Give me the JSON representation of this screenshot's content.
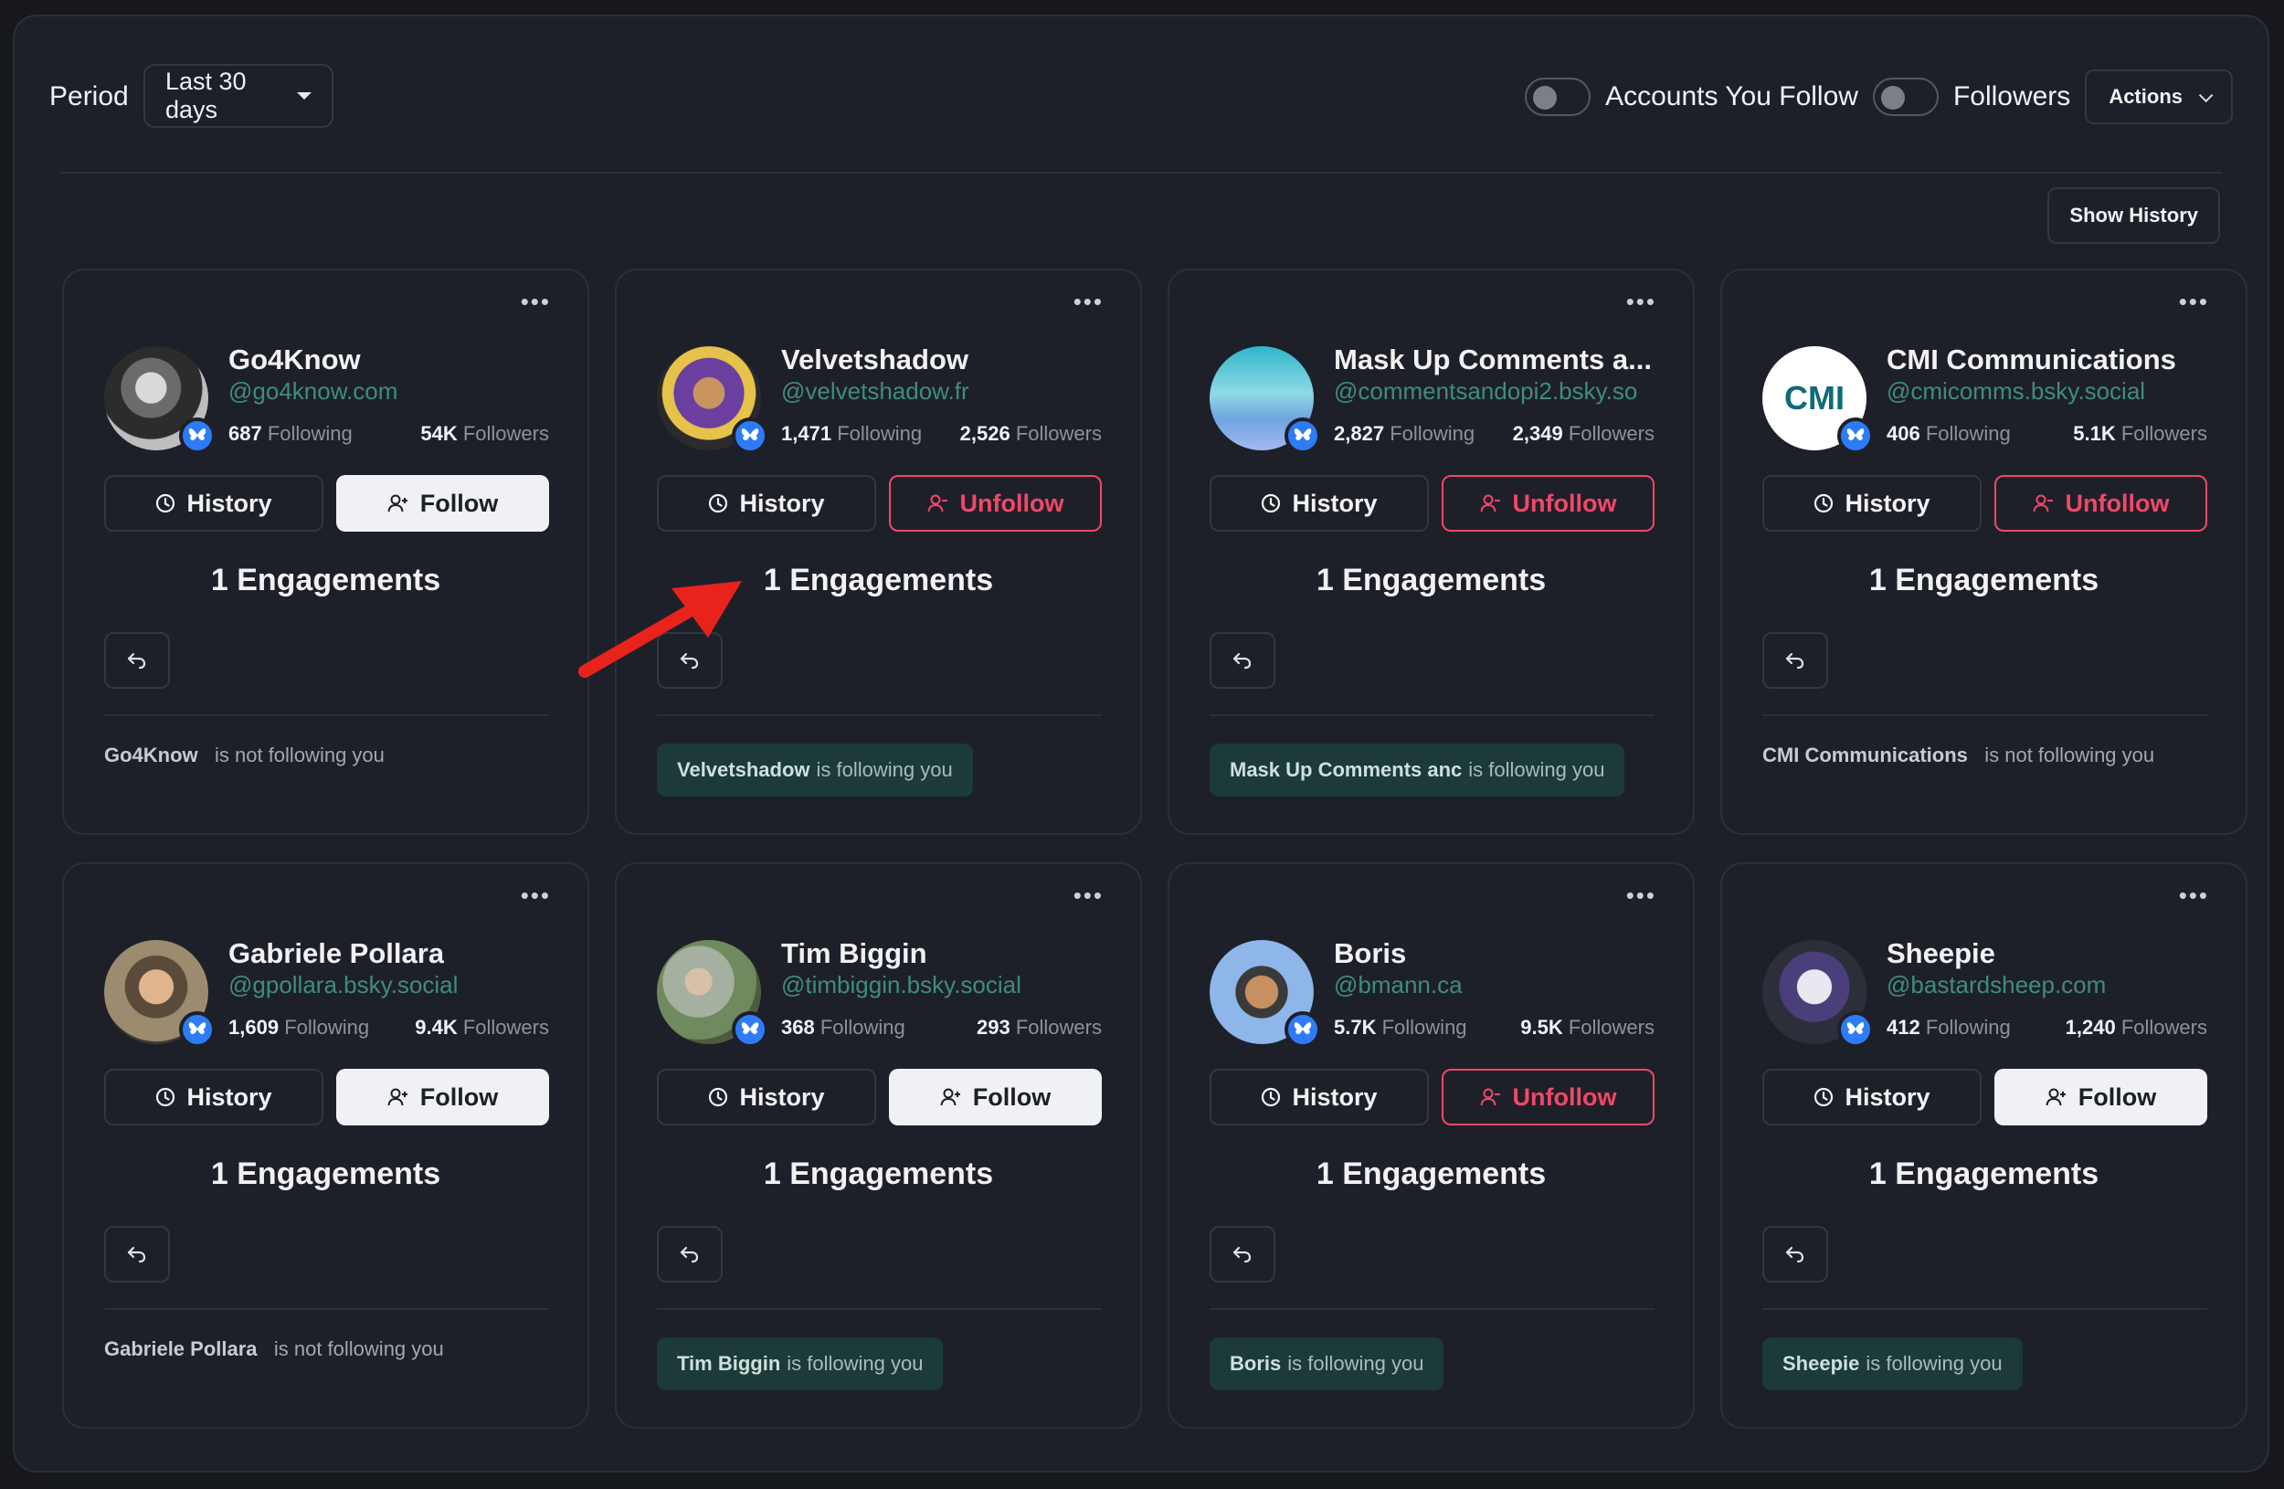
{
  "toolbar": {
    "period_label": "Period",
    "period_value": "Last 30 days",
    "toggle_following_label": "Accounts You Follow",
    "toggle_followers_label": "Followers",
    "actions_label": "Actions",
    "show_history_label": "Show History"
  },
  "colors": {
    "follow_button_bg": "#f0f1f4",
    "unfollow_accent": "#f04868",
    "handle_green": "#3f8d7a",
    "follows_you_pill_bg": "#1b3a39",
    "badge_blue": "#2d7bf7"
  },
  "cards": [
    {
      "name": "Go4Know",
      "handle": "@go4know.com",
      "following": "687",
      "following_label": "Following",
      "followers": "54K",
      "followers_label": "Followers",
      "history_label": "History",
      "action_label": "Follow",
      "engagements": "1 Engagements",
      "status_name": "Go4Know",
      "status_text": "is not following you"
    },
    {
      "name": "Velvetshadow",
      "handle": "@velvetshadow.fr",
      "following": "1,471",
      "following_label": "Following",
      "followers": "2,526",
      "followers_label": "Followers",
      "history_label": "History",
      "action_label": "Unfollow",
      "engagements": "1 Engagements",
      "status_name": "Velvetshadow",
      "status_text": "is following you"
    },
    {
      "name": "Mask Up Comments a...",
      "handle": "@commentsandopi2.bsky.so",
      "following": "2,827",
      "following_label": "Following",
      "followers": "2,349",
      "followers_label": "Followers",
      "history_label": "History",
      "action_label": "Unfollow",
      "engagements": "1 Engagements",
      "status_name": "Mask Up Comments anc",
      "status_text": "is following you"
    },
    {
      "name": "CMI Communications",
      "handle": "@cmicomms.bsky.social",
      "following": "406",
      "following_label": "Following",
      "followers": "5.1K",
      "followers_label": "Followers",
      "history_label": "History",
      "action_label": "Unfollow",
      "engagements": "1 Engagements",
      "status_name": "CMI Communications",
      "status_text": "is not following you",
      "avatar_text": "CMI"
    },
    {
      "name": "Gabriele Pollara",
      "handle": "@gpollara.bsky.social",
      "following": "1,609",
      "following_label": "Following",
      "followers": "9.4K",
      "followers_label": "Followers",
      "history_label": "History",
      "action_label": "Follow",
      "engagements": "1 Engagements",
      "status_name": "Gabriele Pollara",
      "status_text": "is not following you"
    },
    {
      "name": "Tim Biggin",
      "handle": "@timbiggin.bsky.social",
      "following": "368",
      "following_label": "Following",
      "followers": "293",
      "followers_label": "Followers",
      "history_label": "History",
      "action_label": "Follow",
      "engagements": "1 Engagements",
      "status_name": "Tim Biggin",
      "status_text": "is following you"
    },
    {
      "name": "Boris",
      "handle": "@bmann.ca",
      "following": "5.7K",
      "following_label": "Following",
      "followers": "9.5K",
      "followers_label": "Followers",
      "history_label": "History",
      "action_label": "Unfollow",
      "engagements": "1 Engagements",
      "status_name": "Boris",
      "status_text": "is following you"
    },
    {
      "name": "Sheepie",
      "handle": "@bastardsheep.com",
      "following": "412",
      "following_label": "Following",
      "followers": "1,240",
      "followers_label": "Followers",
      "history_label": "History",
      "action_label": "Follow",
      "engagements": "1 Engagements",
      "status_name": "Sheepie",
      "status_text": "is following you"
    }
  ]
}
